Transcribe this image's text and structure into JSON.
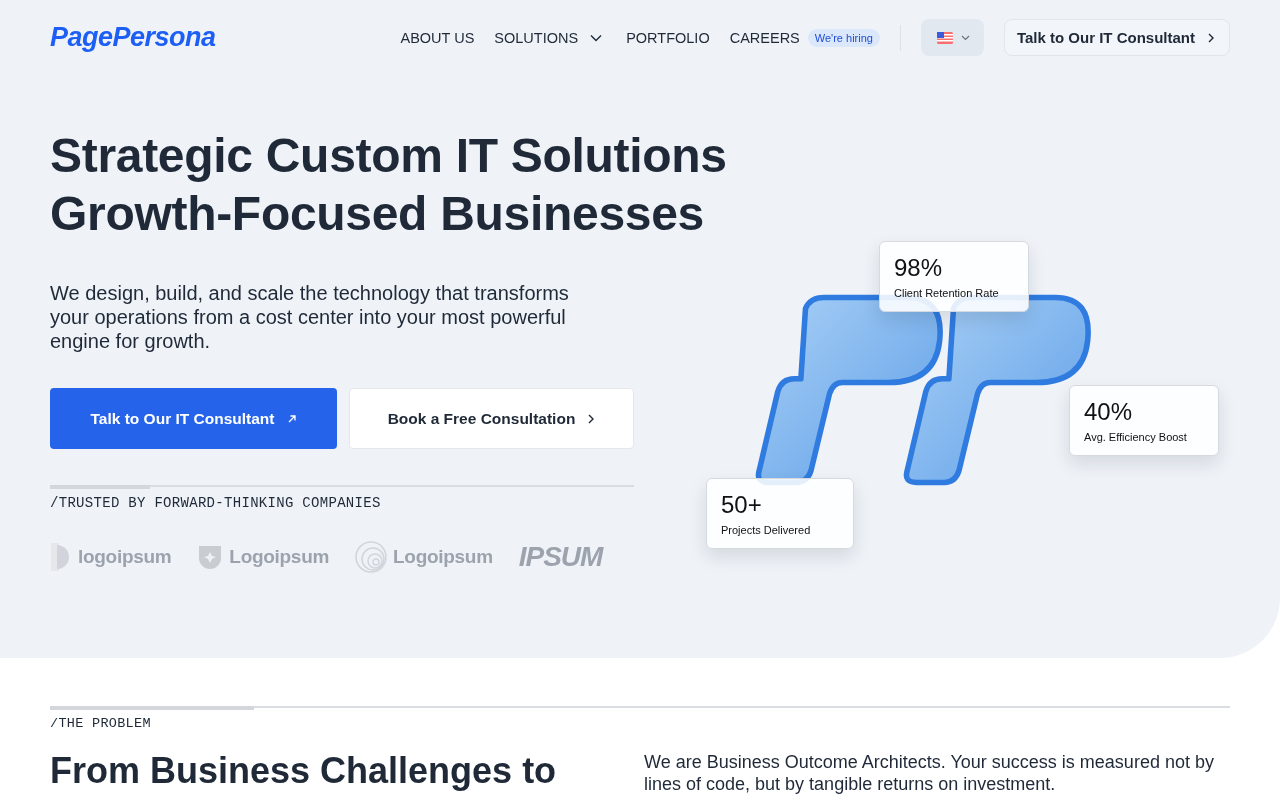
{
  "header": {
    "logo": "PagePersona",
    "nav": [
      {
        "label": "ABOUT US",
        "dropdown": false
      },
      {
        "label": "SOLUTIONS",
        "dropdown": true
      },
      {
        "label": "PORTFOLIO",
        "dropdown": false
      },
      {
        "label": "CAREERS",
        "dropdown": false,
        "badge": "We're hiring"
      }
    ],
    "cta": "Talk to Our IT Consultant"
  },
  "hero": {
    "title_lines": [
      "Strategic Custom IT Solutions",
      "Growth-Focused Businesses"
    ],
    "subtitle": "We design, build, and scale the technology that transforms your operations from a cost center into your most powerful engine for growth.",
    "primary_button": "Talk to Our IT Consultant",
    "secondary_button": "Book a Free Consultation",
    "trusted_label": "/TRUSTED BY FORWARD-THINKING COMPANIES",
    "partner_logos": [
      {
        "kind": "half-circle",
        "name": "logoipsum"
      },
      {
        "kind": "shield",
        "name": "Logoipsum"
      },
      {
        "kind": "rings",
        "name": "Logoipsum"
      },
      {
        "kind": "wordmark",
        "name": "IPSUM"
      }
    ],
    "stats": [
      {
        "value": "98%",
        "label": "Client Retention Rate"
      },
      {
        "value": "40%",
        "label": "Avg. Efficiency Boost"
      },
      {
        "value": "50+",
        "label": "Projects Delivered"
      }
    ]
  },
  "problem": {
    "label": "/THE PROBLEM",
    "title": "From Business Challenges to",
    "text": "We are Business Outcome Architects. Your success is measured not by lines of code, but by tangible returns on investment."
  }
}
